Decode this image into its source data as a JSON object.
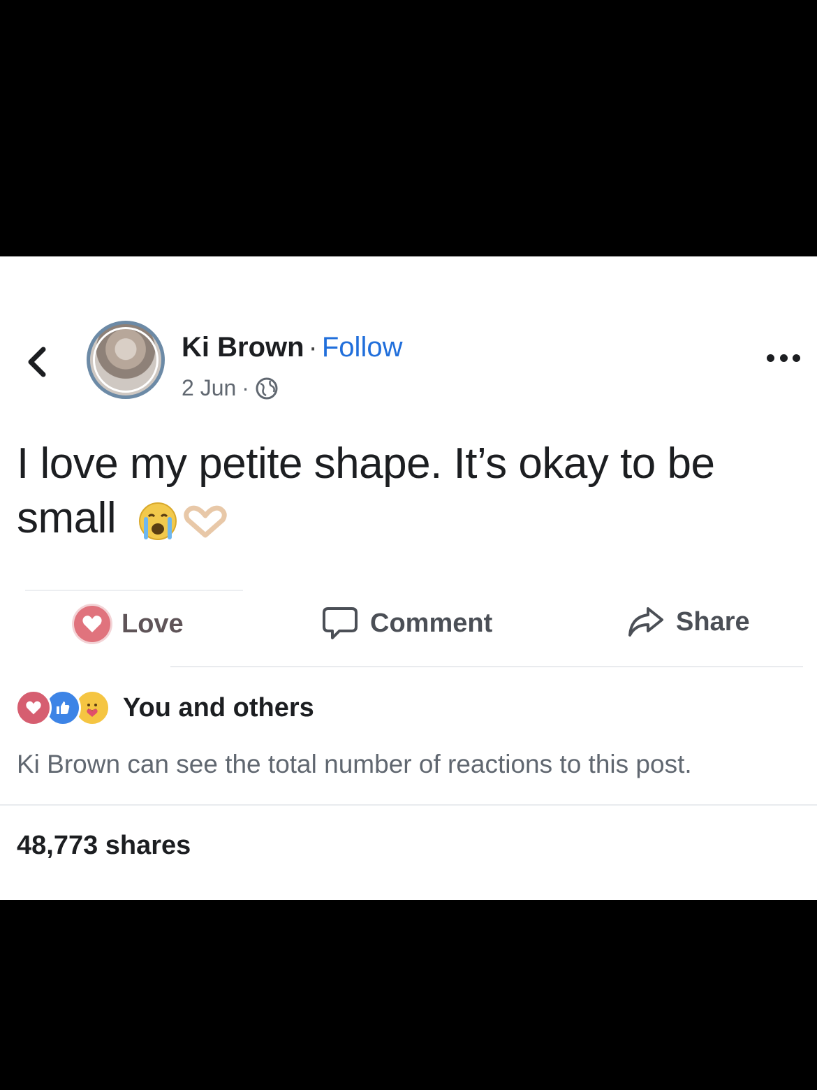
{
  "post": {
    "author_name": "Ki Brown",
    "separator": "·",
    "follow_label": "Follow",
    "date": "2 Jun",
    "meta_separator": "·",
    "text_line1": "I love my petite shape. It’s okay to be",
    "text_line2": "small",
    "emojis": [
      "crying-face-icon",
      "heart-hands-icon"
    ]
  },
  "actions": {
    "love_label": "Love",
    "comment_label": "Comment",
    "share_label": "Share"
  },
  "reactions": {
    "icons": [
      "heart-reaction-icon",
      "like-reaction-icon",
      "care-reaction-icon"
    ],
    "label": "You and others",
    "visibility_note": "Ki Brown can see the total number of reactions to this post."
  },
  "shares": {
    "label": "48,773 shares"
  },
  "colors": {
    "follow_blue": "#216fdb",
    "love_red": "#e0737d",
    "like_blue": "#3d84e6",
    "care_yellow": "#f5c542",
    "text_dark": "#1c1e21",
    "text_secondary": "#606770"
  }
}
